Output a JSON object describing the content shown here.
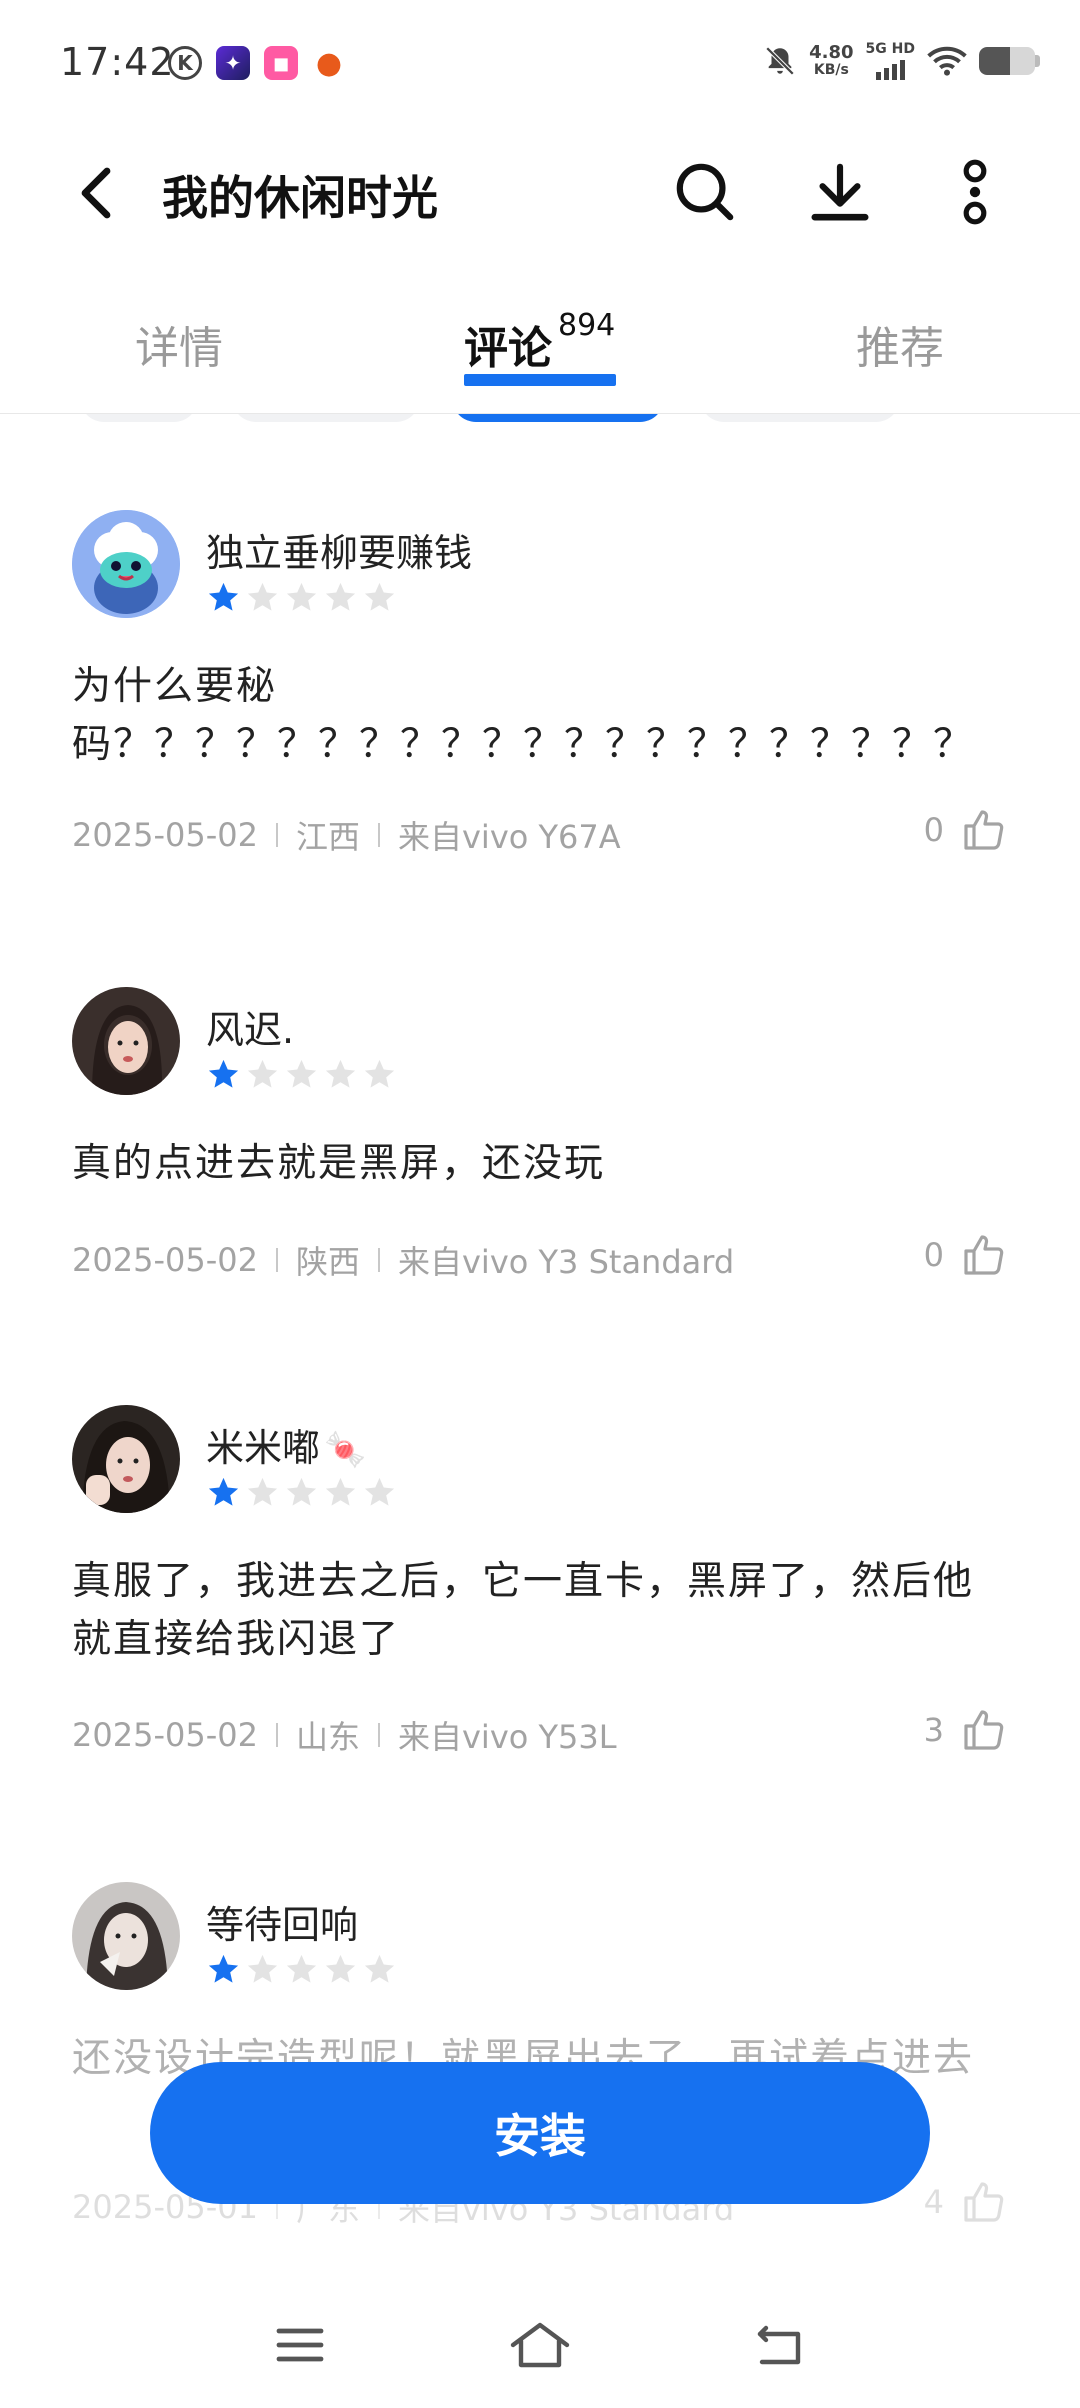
{
  "status_bar": {
    "time": "17:42",
    "net_speed": "4.80",
    "net_unit": "KB/s",
    "sim": "5G HD",
    "notif_icons": [
      "k-icon",
      "game-app-icon",
      "video-app-icon",
      "pumpkin-app-icon"
    ],
    "battery_level": 0.55
  },
  "header": {
    "title": "我的休闲时光"
  },
  "tabs": {
    "details": "详情",
    "comments": "评论",
    "comments_count": "894",
    "recommend": "推荐"
  },
  "comments": [
    {
      "user": "独立垂柳要赚钱",
      "rating": 1,
      "text": "为什么要秘码？？？？？？？？？？？？？？？？？？？？？",
      "date": "2025-05-02",
      "region": "江西",
      "device": "来自vivo Y67A",
      "likes": "0"
    },
    {
      "user": "风迟.",
      "rating": 1,
      "text": "真的点进去就是黑屏，还没玩",
      "date": "2025-05-02",
      "region": "陕西",
      "device": "来自vivo Y3 Standard",
      "likes": "0"
    },
    {
      "user": "米米嘟",
      "user_emoji": "🍬",
      "rating": 1,
      "text": "真服了，我进去之后，它一直卡，黑屏了，然后他就直接给我闪退了",
      "date": "2025-05-02",
      "region": "山东",
      "device": "来自vivo Y53L",
      "likes": "3"
    },
    {
      "user": "等待回响",
      "rating": 1,
      "text": "还没设计完造型呢！就黑屏出去了，再试着点进去",
      "date": "2025-05-01",
      "region": "广东",
      "device": "来自vivo Y3 Standard",
      "likes": "4"
    }
  ],
  "install_button": "安装",
  "colors": {
    "accent": "#1671f0",
    "star_empty": "#e3e3e3"
  }
}
